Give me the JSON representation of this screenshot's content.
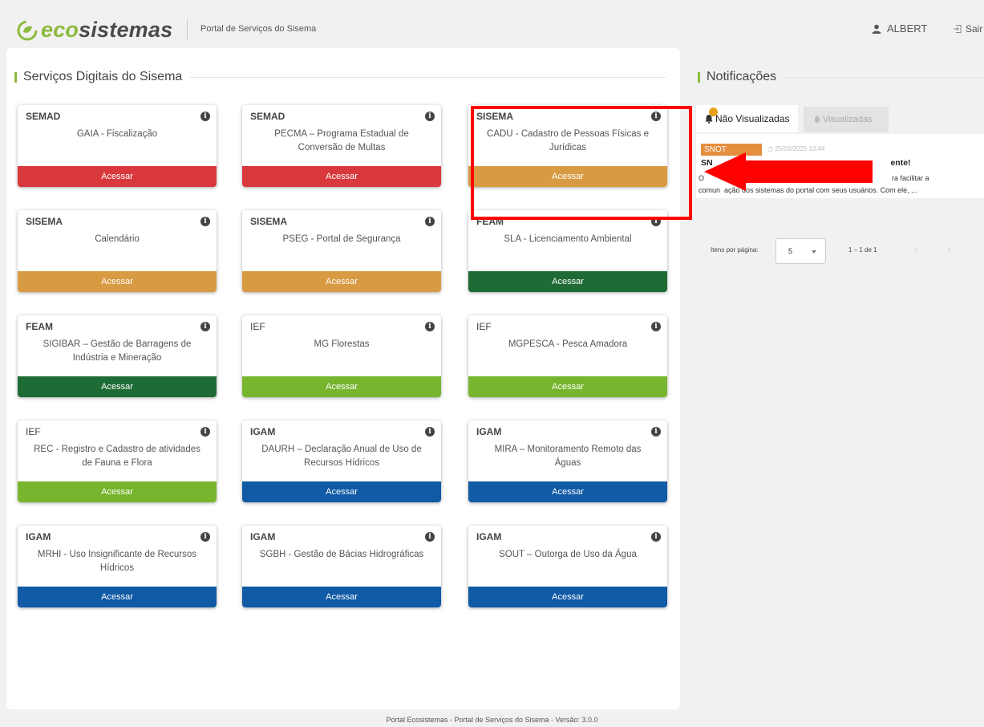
{
  "header": {
    "logo_eco": "eco",
    "logo_sistemas": "sistemas",
    "portal_title": "Portal de Serviços do Sisema",
    "user_name": "ALBERT",
    "logout_label": "Sair",
    "user_icon": "user-icon",
    "logout_icon": "logout-icon"
  },
  "services": {
    "heading": "Serviços Digitais do Sisema",
    "cards": [
      {
        "org": "SEMAD",
        "title": "GAIA - Fiscalização",
        "button": "Acessar",
        "color": "#d9393d"
      },
      {
        "org": "SEMAD",
        "title": "PECMA – Programa Estadual de Conversão de Multas",
        "button": "Acessar",
        "color": "#d9393d"
      },
      {
        "org": "SISEMA",
        "title": "CADU - Cadastro de Pessoas Físicas e Jurídicas",
        "button": "Acessar",
        "color": "#d89a42"
      },
      {
        "org": "SISEMA",
        "title": "Calendário",
        "button": "Acessar",
        "color": "#d89a42"
      },
      {
        "org": "SISEMA",
        "title": "PSEG - Portal de Segurança",
        "button": "Acessar",
        "color": "#d89a42"
      },
      {
        "org": "FEAM",
        "title": "SLA - Licenciamento Ambiental",
        "button": "Acessar",
        "color": "#1f6b36"
      },
      {
        "org": "FEAM",
        "title": "SIGIBAR – Gestão de Barragens de Indústria e Mineração",
        "button": "Acessar",
        "color": "#1f6b36"
      },
      {
        "org": "IEF",
        "title": "MG Florestas",
        "button": "Acessar",
        "color": "#76b52d"
      },
      {
        "org": "IEF",
        "title": "MGPESCA - Pesca Amadora",
        "button": "Acessar",
        "color": "#76b52d"
      },
      {
        "org": "IEF",
        "title": "REC - Registro e Cadastro de atividades de Fauna e Flora",
        "button": "Acessar",
        "color": "#76b52d"
      },
      {
        "org": "IGAM",
        "title": "DAURH – Declaração Anual de Uso de Recursos Hídricos",
        "button": "Acessar",
        "color": "#105aa6"
      },
      {
        "org": "IGAM",
        "title": "MIRA – Monitoramento Remoto das Águas",
        "button": "Acessar",
        "color": "#105aa6"
      },
      {
        "org": "IGAM",
        "title": "MRHI - Uso Insignificante de Recursos Hídricos",
        "button": "Acessar",
        "color": "#105aa6"
      },
      {
        "org": "IGAM",
        "title": "SGBH - Gestão de Bácias Hidrográficas",
        "button": "Acessar",
        "color": "#105aa6"
      },
      {
        "org": "IGAM",
        "title": "SOUT – Outorga de Uso da Água",
        "button": "Acessar",
        "color": "#105aa6"
      }
    ]
  },
  "notifications": {
    "heading": "Notificações",
    "tab_unread": "Não Visualizadas",
    "tab_read": "Visualizadas",
    "item": {
      "tag": "SNOT",
      "time": "25/03/2025 13:44",
      "title_start": "SN",
      "title_end": "ente!",
      "body_line1_start": "O",
      "body_line1_end": "ra facilitar a",
      "body_line2_start": "comun",
      "body_line2_end": "ação dos sistemas do portal com seus usuários. Com ele, ..."
    },
    "pager": {
      "items_per_page_label": "Itens por página:",
      "items_per_page_value": "5",
      "range": "1 – 1 de 1",
      "prev": "‹",
      "next": "›"
    }
  },
  "footer": {
    "text": "Portal Ecosistemas - Portal de Serviços do Sisema - Versão: 3.0.0"
  },
  "annotation_colors": {
    "highlight": "#ff0000"
  }
}
